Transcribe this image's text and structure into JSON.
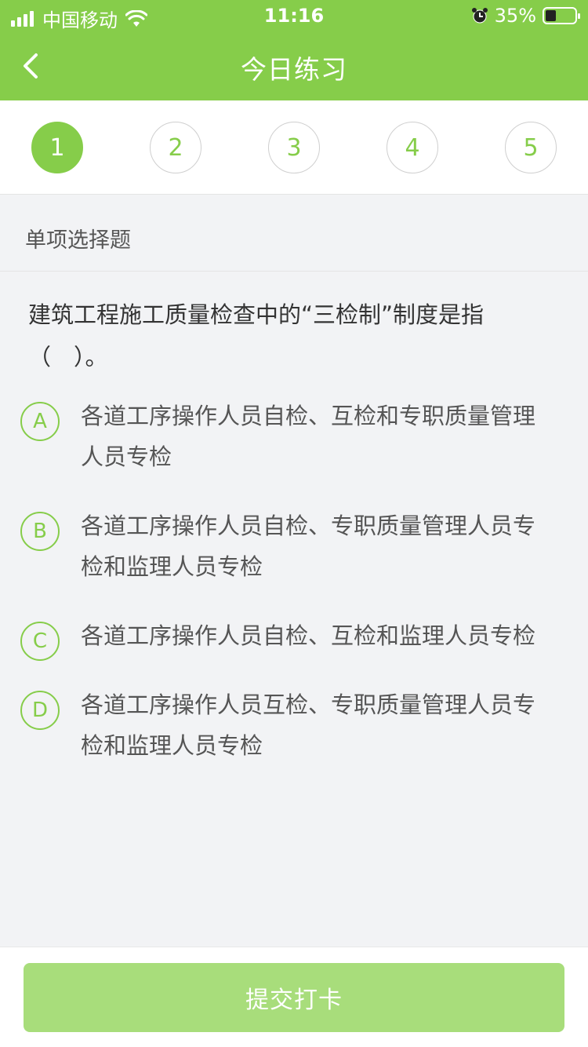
{
  "status_bar": {
    "carrier": "中国移动",
    "time": "11:16",
    "battery": "35%"
  },
  "nav": {
    "title": "今日练习",
    "back_icon": "chevron-left-icon"
  },
  "steps": [
    {
      "label": "1",
      "active": true
    },
    {
      "label": "2",
      "active": false
    },
    {
      "label": "3",
      "active": false
    },
    {
      "label": "4",
      "active": false
    },
    {
      "label": "5",
      "active": false
    }
  ],
  "question_type": "单项选择题",
  "question": {
    "text_line1": "建筑工程施工质量检查中的“三检制”制度是指",
    "text_line2": "（　）。"
  },
  "options": [
    {
      "letter": "A",
      "line1": "各道工序操作人员自检、互检和专职质量管理",
      "line2": "人员专检"
    },
    {
      "letter": "B",
      "line1": "各道工序操作人员自检、专职质量管理人员专",
      "line2": "检和监理人员专检"
    },
    {
      "letter": "C",
      "line1": "各道工序操作人员自检、互检和监理人员专检",
      "line2": ""
    },
    {
      "letter": "D",
      "line1": "各道工序操作人员互检、专职质量管理人员专",
      "line2": "检和监理人员专检"
    }
  ],
  "footer": {
    "submit_label": "提交打卡"
  },
  "colors": {
    "accent": "#86cd4a",
    "submit_disabled": "#a8dd7b",
    "background": "#f2f3f5"
  }
}
